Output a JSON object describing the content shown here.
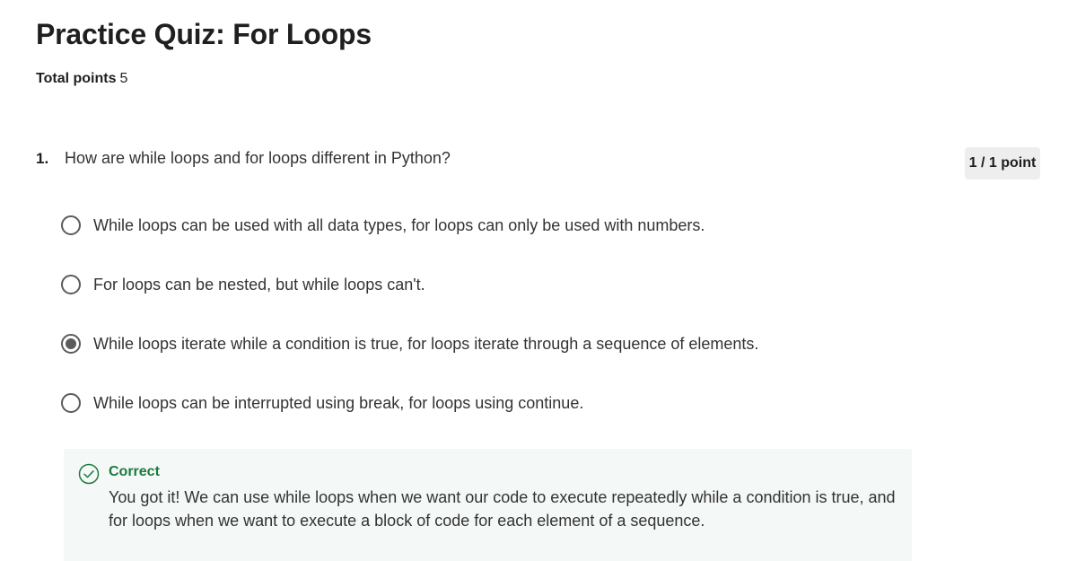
{
  "quiz": {
    "title": "Practice Quiz: For Loops",
    "total_points_label": "Total points",
    "total_points_value": "5"
  },
  "question": {
    "number": "1.",
    "text": "How are while loops and for loops different in Python?",
    "score": "1 / 1 point",
    "options": [
      {
        "label": "While loops can be used with all data types, for loops can only be used with numbers.",
        "selected": false
      },
      {
        "label": "For loops can be nested, but while loops can't.",
        "selected": false
      },
      {
        "label": "While loops iterate while a condition is true, for loops iterate through a sequence of elements.",
        "selected": true
      },
      {
        "label": "While loops can be interrupted using break, for loops using continue.",
        "selected": false
      }
    ]
  },
  "feedback": {
    "icon": "check-circle-icon",
    "status": "Correct",
    "message": "You got it! We can use while loops when we want our code to execute repeatedly while a condition is true, and for loops when we want to execute a block of code for each element of a sequence."
  },
  "colors": {
    "correct": "#1d7a3f",
    "feedback_bg": "#f4f8f6",
    "badge_bg": "#eeeeee",
    "radio": "#5b5b5b"
  }
}
